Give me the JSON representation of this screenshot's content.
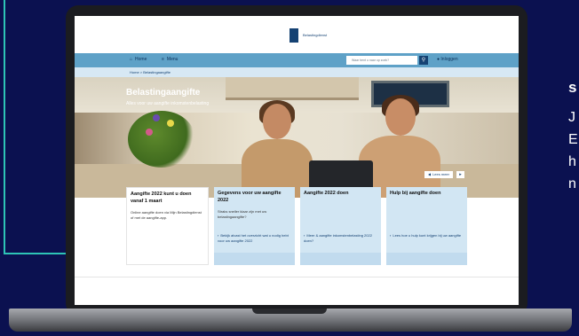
{
  "site": {
    "logo_text": "Belastingdienst"
  },
  "nav": {
    "home_label": "Home",
    "menu_label": "Menu",
    "search_placeholder": "Waar bent u naar op zoek?",
    "login_label": "Inloggen"
  },
  "breadcrumb": {
    "text": "Home > Belastingaangifte"
  },
  "hero": {
    "title": "Belastingaangifte",
    "subtitle": "Alles voor uw aangifte inkomstenbelasting",
    "button_label": "Lees meer"
  },
  "cards": [
    {
      "title": "Aangifte 2022 kunt u doen vanaf 1 maart",
      "body": "Online aangifte doen via Mijn Belastingdienst of met de aangifte-app.",
      "link": ""
    },
    {
      "title": "Gegevens voor uw aangifte 2022",
      "body": "Straks sneller klaar zijn met uw belastingaangifte?",
      "link": "Bekijk alvast het overzicht wat u nodig hebt voor uw aangifte 2022"
    },
    {
      "title": "Aangifte 2022 doen",
      "body": "",
      "link": "Meer & aangifte inkomstenbelasting 2022 doen?"
    },
    {
      "title": "Hulp bij aangifte doen",
      "body": "",
      "link": "Lees hoe u hulp kunt krijgen bij uw aangifte"
    }
  ],
  "side_text": {
    "heading": "s",
    "lines": [
      "J",
      "E",
      "h",
      "n"
    ]
  },
  "colors": {
    "background": "#0b1150",
    "accent": "#2ec4b6",
    "nav": "#5ea1c7",
    "brand": "#154273",
    "card": "#d2e6f3"
  },
  "icons": [
    "home-icon",
    "menu-icon",
    "search-icon",
    "user-icon",
    "arrow-right-icon"
  ]
}
